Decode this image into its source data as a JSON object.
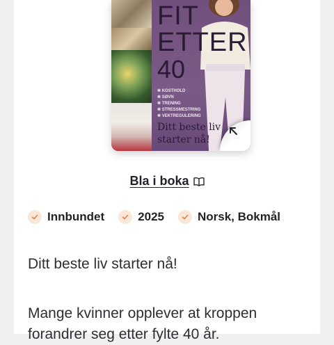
{
  "cover": {
    "title_line1": "FIT",
    "title_line2": "ETTER",
    "title_line3": "40",
    "bullets": [
      "KOSTHOLD",
      "SØVN",
      "TRENING",
      "STRESSMESTRING",
      "VEKTREGULERING"
    ],
    "slogan_line1": "Ditt beste liv",
    "slogan_line2": "starter nå!",
    "corner_icon": "arrow-up-left-icon"
  },
  "browse": {
    "label": "Bla i boka",
    "icon": "open-book-icon"
  },
  "meta": [
    {
      "label": "Innbundet",
      "icon": "check-icon"
    },
    {
      "label": "2025",
      "icon": "check-icon"
    },
    {
      "label": "Norsk, Bokmål",
      "icon": "check-icon"
    }
  ],
  "description": {
    "line1": "Ditt beste liv starter nå!",
    "para2": "Mange kvinner opplever at kroppen forandrer seg etter fylte 40 år."
  },
  "colors": {
    "check_bg": "#fbe7d7",
    "check_mark": "#d9824a",
    "cover_bg": "#72507d"
  }
}
